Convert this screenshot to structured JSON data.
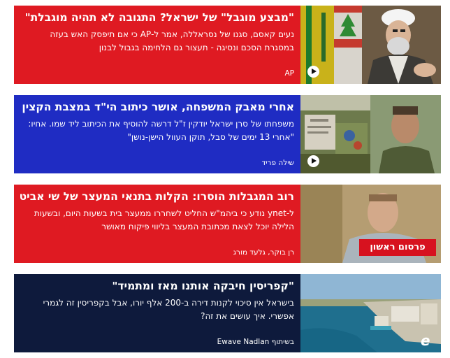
{
  "colors": {
    "red": "#df1a22",
    "blue": "#1f2cc3",
    "navy": "#0e1a3c"
  },
  "cards": [
    {
      "headline": "\"מבצע מוגבל\" של ישראל? התגובה לא תהיה מוגבלת\"",
      "summary": "נעים קאסם, סגנו של נסראללה, אמר ל-AP כי אם תיפסק האש בעזה במסגרת הסכם ונסיגה - תעצור גם הלחימה בגבול לבנון",
      "credit": "AP",
      "media_icon": "play-icon"
    },
    {
      "headline": "אחרי מאבק המשפחה, אושר כיתוב הי\"ד במצבת הקצין",
      "summary": "משפחתו של סרן ישראל יודקין ז\"ל דרשה להוסיף את הכיתוב ליד שמו. אחיו: \"אחרי 13 ימים של סבל, תוקן העוול הישן-נושן\"",
      "credit": "שילה פריד",
      "media_icon": "play-icon"
    },
    {
      "headline": "רוב המגבלות הוסרו: הקלות בתנאי המעצר של שי אביטל",
      "summary": "ל-ynet נודע כי ביהמ\"ש החליט לשחררו ממעצר בית בשעות היום, ובשעות הלילה יוכל לצאת מכתובת המעצר בליווי פיקוח מאושר",
      "credit": "רן בוקר, גלעד מורג",
      "badge": "פרסום ראשון"
    },
    {
      "headline": "\"קפריסין חיבקה אותנו מאז ומתמיד\"",
      "summary": "בישראל אין סיכוי לקנות דירה ב-200 אלף יורו, אבל בקפריסין זה לגמרי אפשרי. איך עושים את זה?",
      "credit": "בשיתוף Ewave Nadlan",
      "media_icon": "ewave-logo-icon",
      "media_logo_text": "e"
    }
  ]
}
